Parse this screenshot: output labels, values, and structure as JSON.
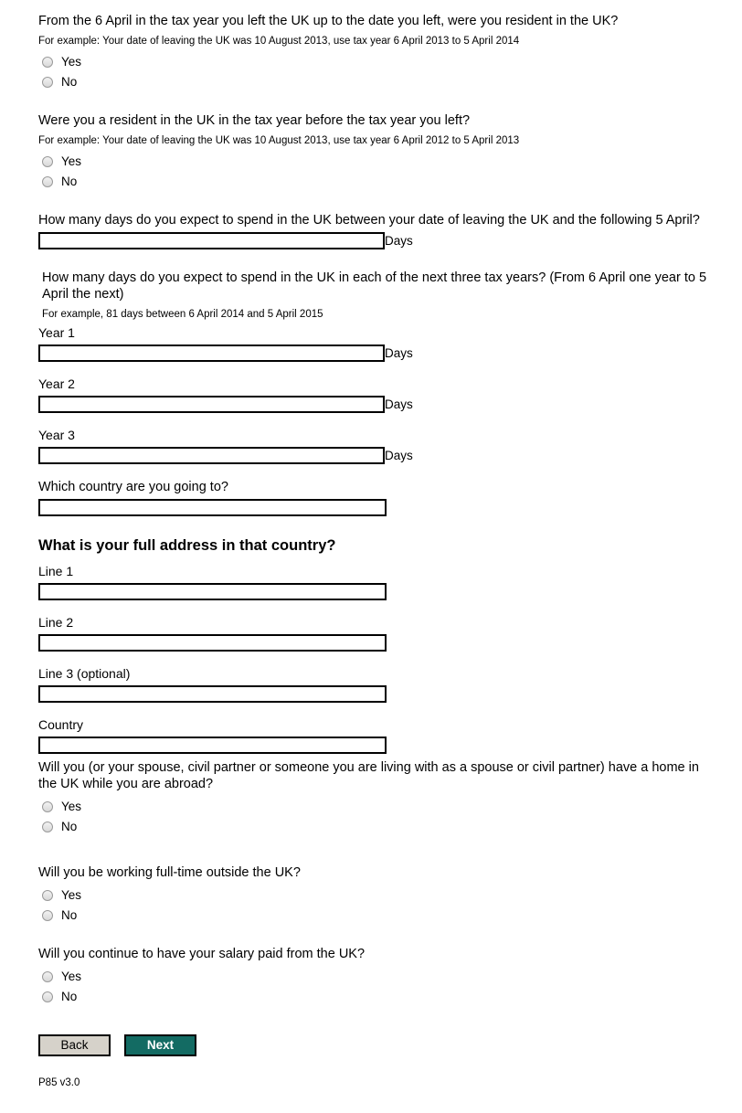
{
  "form": {
    "sections": [
      {
        "id": "resident-from-6-april",
        "question": "From the 6 April in the tax year you left the UK up to the date you left, were you resident in the UK?",
        "example": "For example: Your date of leaving the UK was 10 August 2013, use tax year 6 April 2013 to 5 April 2014",
        "options": [
          "Yes",
          "No"
        ]
      },
      {
        "id": "resident-year-before",
        "question": "Were you a resident in the UK in the tax year before the tax year you left?",
        "example": "For example: Your date of leaving the UK was 10 August 2013, use tax year 6 April 2012 to 5 April 2013",
        "options": [
          "Yes",
          "No"
        ]
      }
    ],
    "days_until_5_april": {
      "question": "How many days do you expect to spend in the UK between your date of leaving the UK and the following 5 April?",
      "unit": "Days",
      "value": ""
    },
    "days_next_three_years": {
      "question": "How many days do you expect to spend in the UK in each of the next three tax years? (From 6 April one year to 5 April the next)",
      "example": "For example, 81 days between 6 April 2014 and 5 April 2015",
      "unit": "Days",
      "years": [
        {
          "label": "Year 1",
          "value": ""
        },
        {
          "label": "Year 2",
          "value": ""
        },
        {
          "label": "Year 3",
          "value": ""
        }
      ]
    },
    "destination_country": {
      "question": "Which country are you going to?",
      "value": ""
    },
    "address": {
      "heading": "What is your full address in that country?",
      "fields": [
        {
          "label": "Line 1",
          "value": ""
        },
        {
          "label": "Line 2",
          "value": ""
        },
        {
          "label": "Line 3 (optional)",
          "value": ""
        },
        {
          "label": "Country",
          "value": ""
        }
      ]
    },
    "home_in_uk": {
      "question": "Will you (or your spouse, civil partner or someone you are living with as a spouse or civil partner) have a home in the UK while you are abroad?",
      "options": [
        "Yes",
        "No"
      ]
    },
    "working_full_time": {
      "question": "Will you be working full-time outside the UK?",
      "options": [
        "Yes",
        "No"
      ]
    },
    "salary_from_uk": {
      "question": "Will you continue to have your salary paid from the UK?",
      "options": [
        "Yes",
        "No"
      ]
    }
  },
  "actions": {
    "back_label": "Back",
    "next_label": "Next"
  },
  "footer": {
    "form_version": "P85 v3.0"
  },
  "colors": {
    "next_button_background": "#136b63",
    "back_button_background": "#d6d2ca",
    "border": "#000000"
  }
}
